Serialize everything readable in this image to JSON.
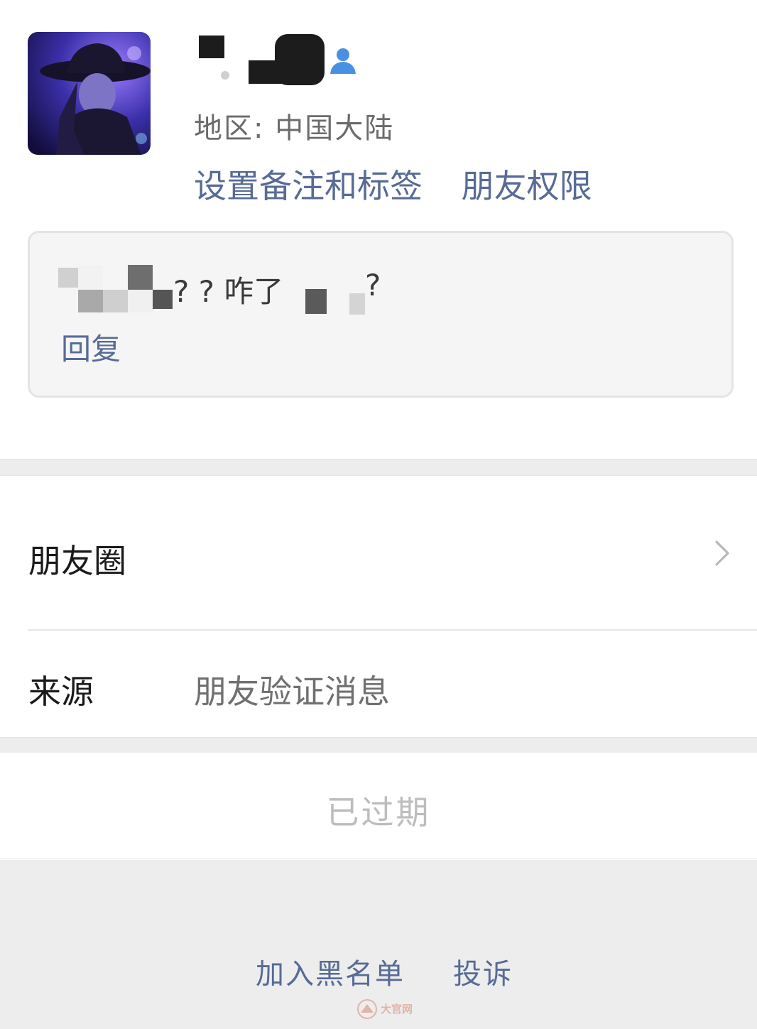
{
  "profile": {
    "region_label": "地区:",
    "region_value": "中国大陆",
    "set_remark_link": "设置备注和标签",
    "friend_permission_link": "朋友权限"
  },
  "message": {
    "visible_text": "? ? 咋了",
    "trailing_text": "?",
    "reply_label": "回复"
  },
  "menu": {
    "moments_label": "朋友圈",
    "source_label": "来源",
    "source_value": "朋友验证消息"
  },
  "status": {
    "expired_label": "已过期"
  },
  "footer": {
    "blacklist_label": "加入黑名单",
    "complain_label": "投诉"
  },
  "colors": {
    "link_blue": "#576b95",
    "gender_icon": "#4a90e2",
    "background_gray": "#ededed"
  },
  "icons": {
    "gender": "male-user-icon",
    "chevron": "chevron-right-icon"
  }
}
